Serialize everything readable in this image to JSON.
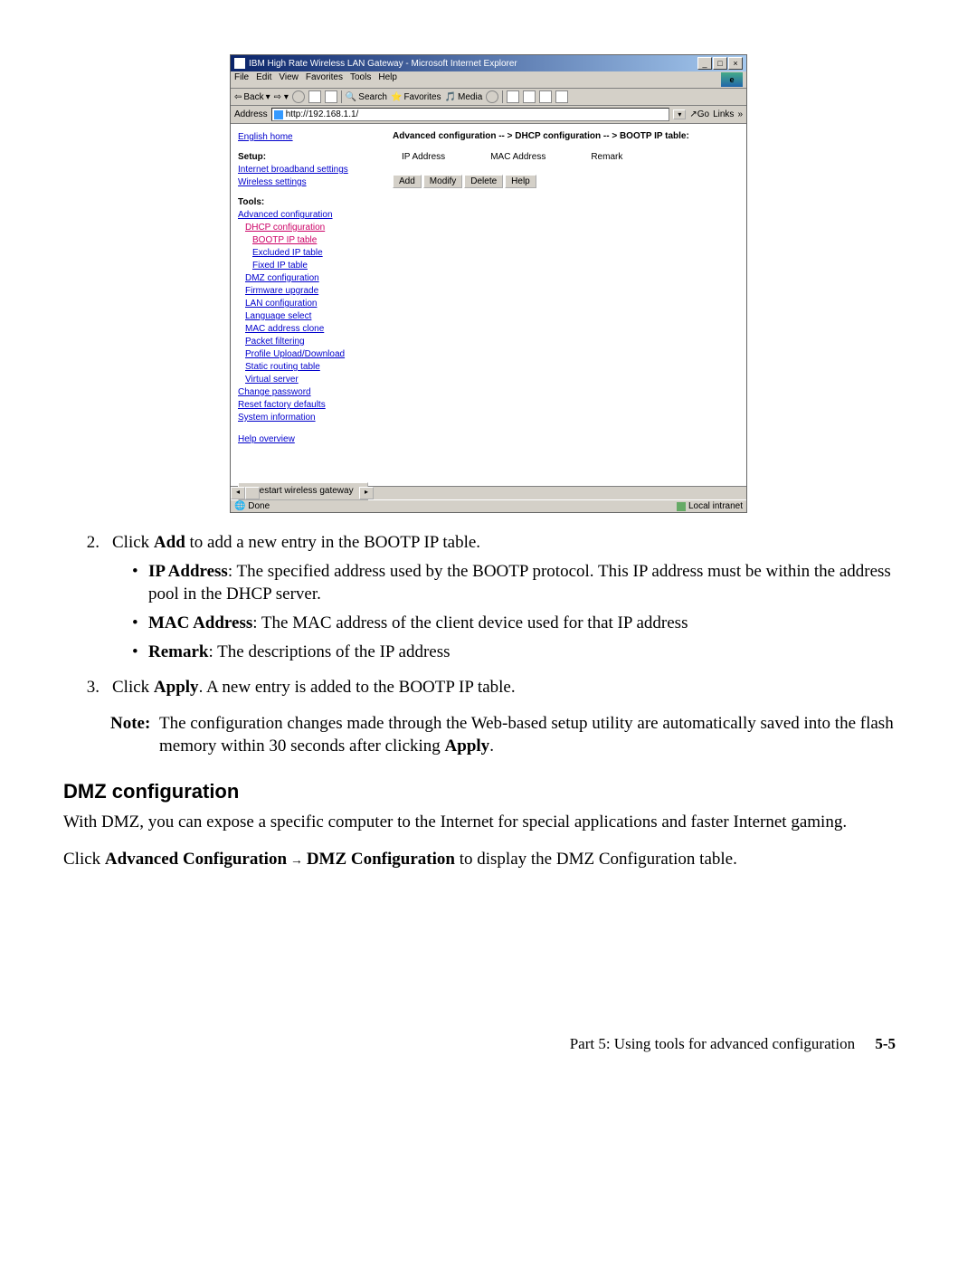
{
  "browser": {
    "title": "IBM High Rate Wireless LAN Gateway - Microsoft Internet Explorer",
    "menus": {
      "file": "File",
      "edit": "Edit",
      "view": "View",
      "favorites": "Favorites",
      "tools": "Tools",
      "help": "Help"
    },
    "toolbar": {
      "back": "Back",
      "search": "Search",
      "favorites": "Favorites",
      "media": "Media"
    },
    "addressLabel": "Address",
    "addressValue": "http://192.168.1.1/",
    "go": "Go",
    "links": "Links",
    "statusDone": "Done",
    "statusZone": "Local intranet"
  },
  "sidebar": {
    "english_home": "English home",
    "setup": "Setup:",
    "internet_bb": "Internet broadband settings",
    "wireless": "Wireless settings",
    "tools": "Tools:",
    "adv_conf": "Advanced configuration",
    "dhcp_conf": "DHCP configuration",
    "bootp": "BOOTP IP table",
    "excluded": "Excluded IP table",
    "fixed": "Fixed IP table",
    "dmz": "DMZ configuration",
    "firmware": "Firmware upgrade",
    "lan": "LAN configuration",
    "language": "Language select",
    "mac_clone": "MAC address clone",
    "packet": "Packet filtering",
    "profile": "Profile Upload/Download",
    "static_route": "Static routing table",
    "virtual": "Virtual server",
    "change_pw": "Change password",
    "reset": "Reset factory defaults",
    "sysinfo": "System information",
    "help_ov": "Help overview",
    "restart": "Restart wireless gateway"
  },
  "main": {
    "breadcrumb": "Advanced configuration -- > DHCP configuration -- > BOOTP IP table:",
    "col_ip": "IP Address",
    "col_mac": "MAC Address",
    "col_remark": "Remark",
    "btn_add": "Add",
    "btn_modify": "Modify",
    "btn_delete": "Delete",
    "btn_help": "Help"
  },
  "doc": {
    "step2_num": "2.",
    "step2_a": "Click ",
    "step2_b": "Add",
    "step2_c": " to add a new entry in the BOOTP IP table.",
    "bullet1_b": "IP Address",
    "bullet1_t": ": The specified address used by the BOOTP protocol. This IP address must be within the address pool in the DHCP server.",
    "bullet2_b": "MAC Address",
    "bullet2_t": ": The MAC address of the client device used for that IP address",
    "bullet3_b": "Remark",
    "bullet3_t": ": The descriptions of the IP address",
    "step3_num": "3.",
    "step3_a": "Click ",
    "step3_b": "Apply",
    "step3_c": ". A new entry is added to the BOOTP IP table.",
    "note_label": "Note:",
    "note_a": "The configuration changes made through the Web-based setup utility are automatically saved into the flash memory within 30 seconds after clicking ",
    "note_b": "Apply",
    "note_c": ".",
    "h_dmz": "DMZ configuration",
    "dmz_p": "With DMZ, you can expose a specific computer to the Internet for special applications and faster Internet gaming.",
    "dmz2_a": "Click ",
    "dmz2_b": "Advanced Configuration",
    "dmz2_arrow": " → ",
    "dmz2_c": "DMZ Configuration",
    "dmz2_d": " to display the DMZ Configuration table.",
    "footer_text": "Part 5: Using tools for advanced configuration",
    "footer_page": "5-5"
  }
}
